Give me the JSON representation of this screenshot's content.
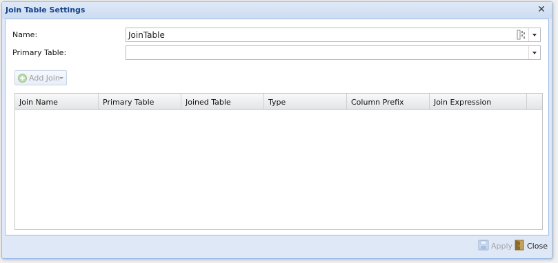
{
  "window": {
    "title": "Join Table Settings",
    "close_glyph": "✕"
  },
  "form": {
    "name_label": "Name:",
    "name_value": "JoinTable",
    "primary_table_label": "Primary Table:",
    "primary_table_value": ""
  },
  "toolbar": {
    "add_join_label": "Add Join"
  },
  "grid": {
    "columns": [
      "Join Name",
      "Primary Table",
      "Joined Table",
      "Type",
      "Column Prefix",
      "Join Expression"
    ],
    "rows": []
  },
  "footer": {
    "apply_label": "Apply",
    "close_label": "Close"
  }
}
